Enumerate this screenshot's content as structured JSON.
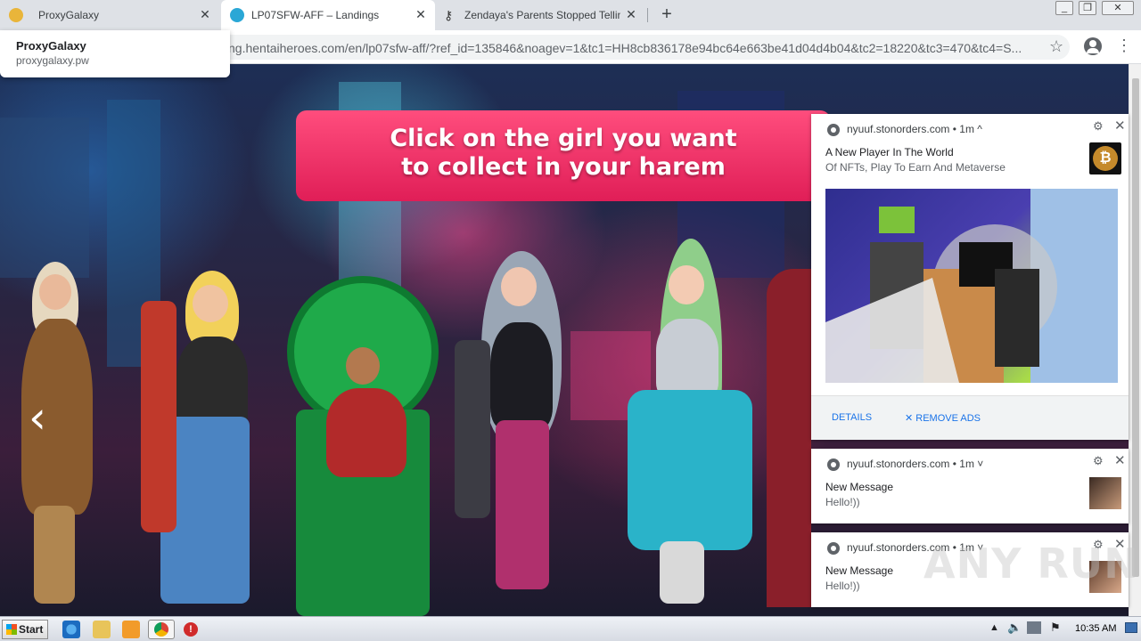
{
  "browser": {
    "tabs": [
      {
        "title": "ProxyGalaxy",
        "icon": "proxygalaxy-favicon"
      },
      {
        "title": "LP07SFW-AFF – Landings",
        "icon": "hentaiheroes-favicon"
      },
      {
        "title": "Zendaya's Parents Stopped Telling H",
        "icon": "key-favicon"
      }
    ],
    "address": "ng.hentaiheroes.com/en/lp07sfw-aff/?ref_id=135846&noagev=1&tc1=HH8cb836178e94bc64e663be41d04d4b04&tc2=18220&tc3=470&tc4=S...",
    "hover_card": {
      "title": "ProxyGalaxy",
      "url": "proxygalaxy.pw"
    }
  },
  "page": {
    "banner_line1": "Click on the girl you want",
    "banner_line2": "to collect in your harem",
    "accent_color": "#e01e57"
  },
  "notifications": [
    {
      "source": "nyuuf.stonorders.com",
      "age": "1m",
      "chevron": "^",
      "title": "A New Player In The World",
      "body": "Of NFTs, Play To Earn And Metaverse",
      "details_label": "DETAILS",
      "remove_label": "✕ REMOVE ADS"
    },
    {
      "source": "nyuuf.stonorders.com",
      "age": "1m",
      "chevron": "˅",
      "title": "New Message",
      "body": "Hello!))"
    },
    {
      "source": "nyuuf.stonorders.com",
      "age": "1m",
      "chevron": "˅",
      "title": "New Message",
      "body": "Hello!))"
    }
  ],
  "watermark": "ANY RUN",
  "taskbar": {
    "start_label": "Start",
    "clock": "10:35 AM"
  }
}
